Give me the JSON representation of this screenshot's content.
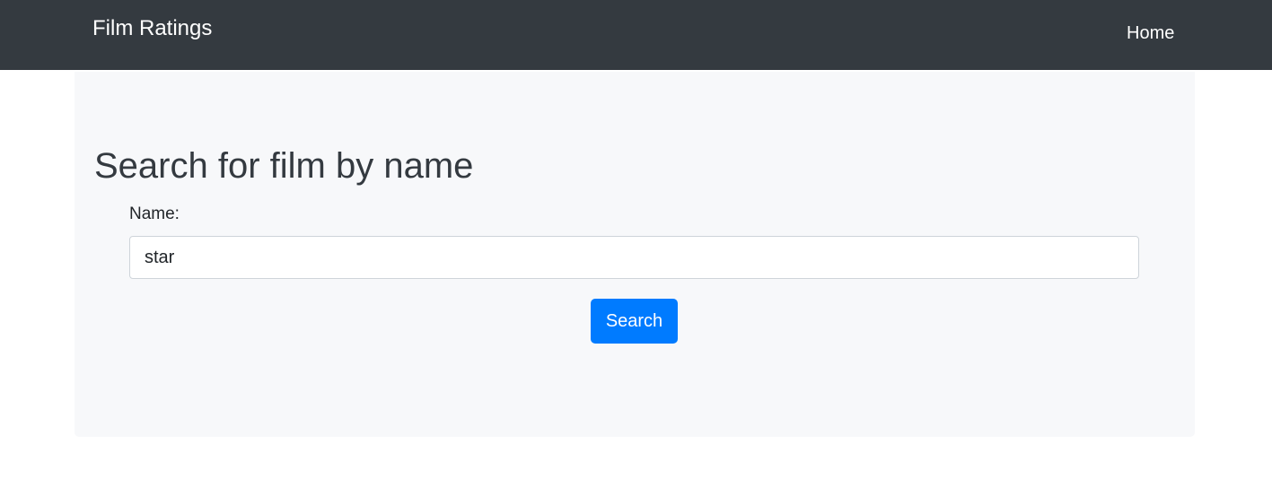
{
  "navbar": {
    "brand": "Film Ratings",
    "home_link": "Home"
  },
  "main": {
    "heading": "Search for film by name",
    "name_label": "Name:",
    "name_value": "star",
    "search_button": "Search"
  }
}
